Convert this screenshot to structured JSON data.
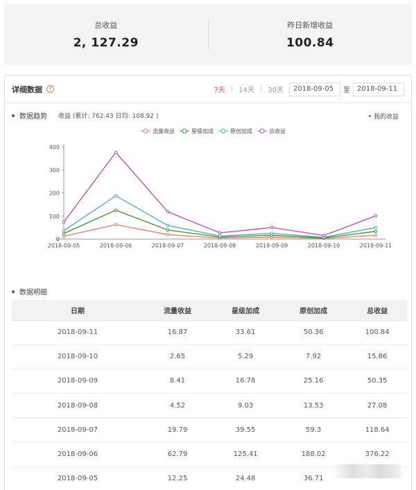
{
  "summary": {
    "total_label": "总收益",
    "total_value": "2, 127.29",
    "yesterday_label": "昨日新增收益",
    "yesterday_value": "100.84"
  },
  "panel": {
    "title": "详细数据",
    "help_icon": "question-circle-icon",
    "ranges": [
      "7天",
      "14天",
      "30天"
    ],
    "active_range": "7天",
    "start_date": "2018-09-05",
    "to_label": "至",
    "end_date": "2018-09-11"
  },
  "trend": {
    "section_title": "数据趋势",
    "subtitle": "收益 (累计: 762.43 日均: 108.92 )",
    "my_income_label": "我的收益"
  },
  "chart_data": {
    "type": "line",
    "categories": [
      "2018-09-05",
      "2018-09-06",
      "2018-09-07",
      "2018-09-08",
      "2018-09-09",
      "2018-09-10",
      "2018-09-11"
    ],
    "ylim": [
      0,
      400
    ],
    "yticks": [
      0,
      100,
      200,
      300,
      400
    ],
    "legend_position": "top",
    "series": [
      {
        "name": "流量收益",
        "color": "#e07a6a",
        "values": [
          12.25,
          62.79,
          19.79,
          4.52,
          8.41,
          2.65,
          16.87
        ]
      },
      {
        "name": "星级加成",
        "color": "#3e8a2c",
        "values": [
          24.48,
          125.41,
          39.55,
          9.03,
          16.78,
          5.29,
          33.61
        ]
      },
      {
        "name": "原创加成",
        "color": "#4aa6b8",
        "values": [
          36.71,
          188.02,
          59.3,
          13.53,
          25.16,
          7.92,
          50.36
        ]
      },
      {
        "name": "总收益",
        "color": "#b04ab8",
        "values": [
          73.44,
          376.22,
          118.64,
          27.08,
          50.35,
          15.86,
          100.84
        ]
      }
    ]
  },
  "detail": {
    "section_title": "数据明细",
    "headers": [
      "日期",
      "流量收益",
      "星级加成",
      "原创加成",
      "总收益"
    ],
    "rows": [
      [
        "2018-09-11",
        "16.87",
        "33.61",
        "50.36",
        "100.84"
      ],
      [
        "2018-09-10",
        "2.65",
        "5.29",
        "7.92",
        "15.86"
      ],
      [
        "2018-09-09",
        "8.41",
        "16.78",
        "25.16",
        "50.35"
      ],
      [
        "2018-09-08",
        "4.52",
        "9.03",
        "13.53",
        "27.08"
      ],
      [
        "2018-09-07",
        "19.79",
        "39.55",
        "59.3",
        "118.64"
      ],
      [
        "2018-09-06",
        "62.79",
        "125.41",
        "188.02",
        "376.22"
      ],
      [
        "2018-09-05",
        "12.25",
        "24.48",
        "36.71",
        ""
      ]
    ]
  }
}
